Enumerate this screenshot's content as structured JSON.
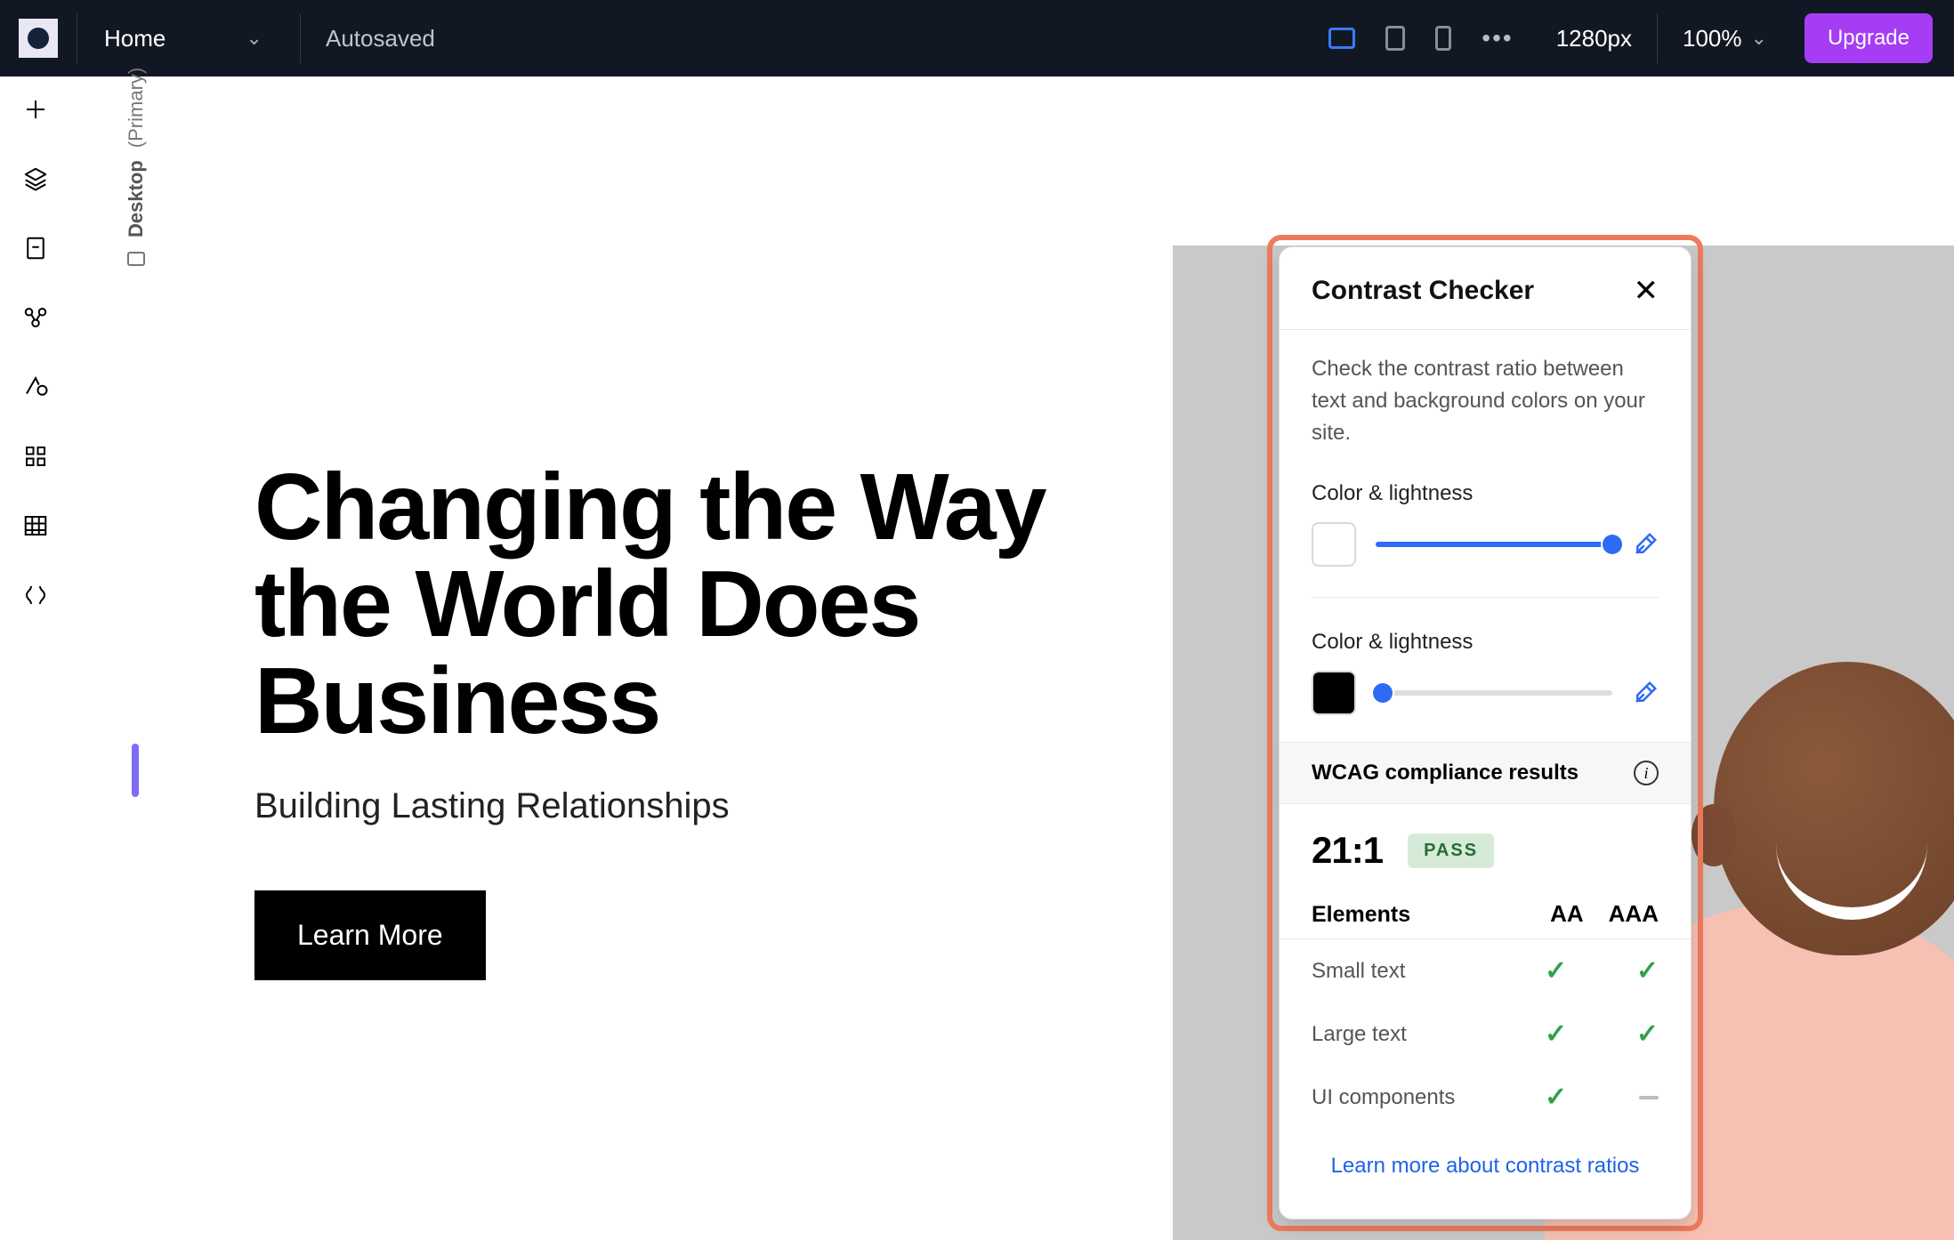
{
  "topbar": {
    "page_name": "Home",
    "autosave": "Autosaved",
    "dimensions": "1280px",
    "zoom": "100%",
    "upgrade": "Upgrade"
  },
  "canvas": {
    "breakpoint_label": "Desktop",
    "breakpoint_suffix": "(Primary)"
  },
  "hero": {
    "title": "Changing the Way the World Does Business",
    "subtitle": "Building Lasting Relationships",
    "cta": "Learn More"
  },
  "contrast_checker": {
    "title": "Contrast Checker",
    "description": "Check the contrast ratio between text and background colors on your site.",
    "group1_label": "Color & lightness",
    "group2_label": "Color & lightness",
    "color1": "#FFFFFF",
    "color2": "#000000",
    "wcag_heading": "WCAG compliance results",
    "ratio": "21:1",
    "pass_label": "PASS",
    "elements_label": "Elements",
    "col_aa": "AA",
    "col_aaa": "AAA",
    "rows": {
      "small": "Small text",
      "large": "Large text",
      "ui": "UI components"
    },
    "link": "Learn more about contrast ratios"
  }
}
